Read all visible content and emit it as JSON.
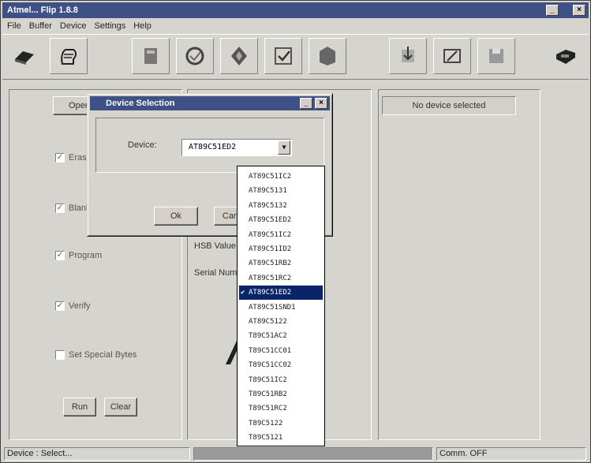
{
  "window": {
    "title": "Atmel... Flip 1.8.8"
  },
  "menu": [
    "File",
    "Buffer",
    "Device",
    "Settings",
    "Help"
  ],
  "toolbar": [
    {
      "name": "open-icon"
    },
    {
      "name": "glove-icon"
    },
    {
      "name": "erase-icon"
    },
    {
      "name": "blank-check-icon"
    },
    {
      "name": "program-icon"
    },
    {
      "name": "verify-icon"
    },
    {
      "name": "read-icon"
    },
    {
      "name": "load-buffer-icon"
    },
    {
      "name": "edit-buffer-icon"
    },
    {
      "name": "save-buffer-icon"
    },
    {
      "name": "help-icon"
    }
  ],
  "left_panel": {
    "operations_button": "Operations Flow",
    "erase": "Erase",
    "blank_check": "Blank Check",
    "program": "Program",
    "verify": "Verify",
    "set_special_bytes": "Set Special Bytes",
    "run_button": "Run",
    "clear_button": "Clear"
  },
  "mid_panel": {
    "hsb_label": "HSB Value",
    "serial_label": "Serial Num..."
  },
  "right_panel": {
    "device_label": "No device selected"
  },
  "dialog": {
    "title": "Device Selection",
    "device_label": "Device:",
    "selected_device": "AT89C51ED2",
    "ok_button": "Ok",
    "cancel_button": "Cancel"
  },
  "dropdown": {
    "items": [
      "AT89C51IC2",
      "AT89C5131",
      "AT89C5132",
      "AT89C51ED2",
      "AT89C51IC2",
      "AT89C51ID2",
      "AT89C51RB2",
      "AT89C51RC2",
      "AT89C51ED2",
      "AT89C51SND1",
      "AT89C5122",
      "T89C51AC2",
      "T89C51CC01",
      "T89C51CC02",
      "T89C51IC2",
      "T89C51RB2",
      "T89C51RC2",
      "T89C5122",
      "T89C5121"
    ],
    "selected_index": 8
  },
  "status": {
    "device": "Device : Select...",
    "comm": "Comm. OFF"
  }
}
